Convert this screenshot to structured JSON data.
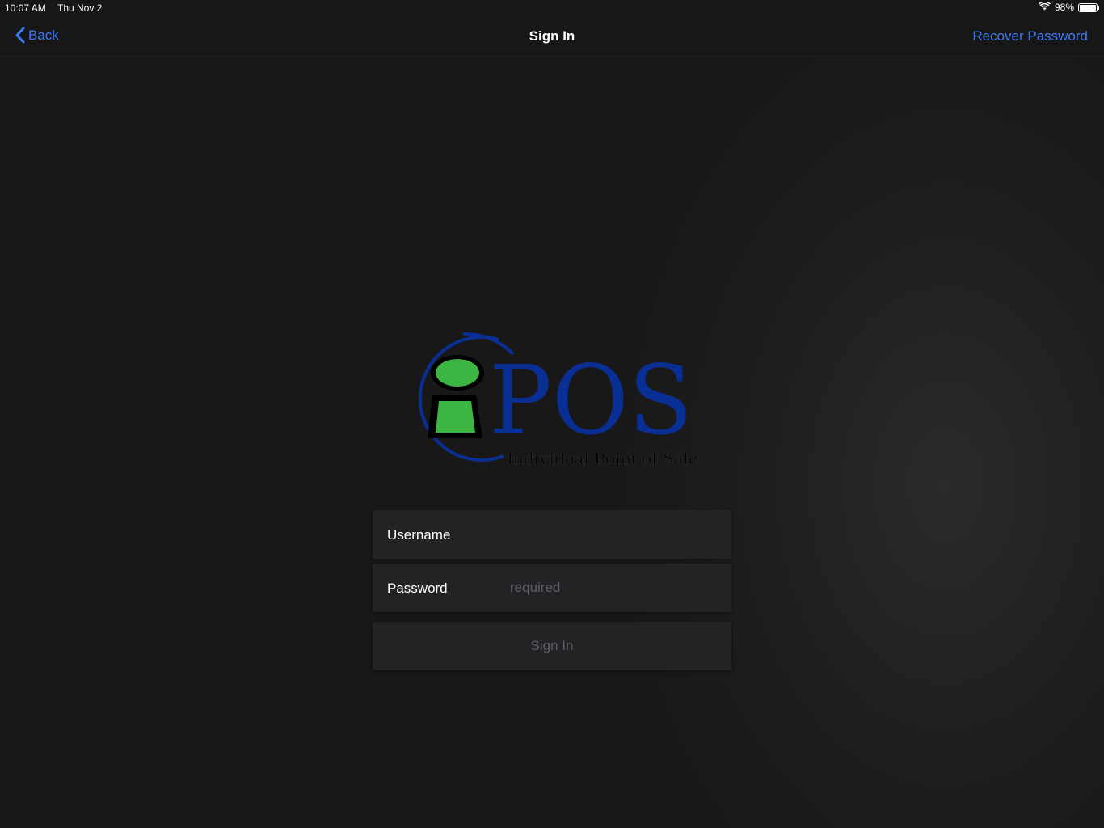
{
  "status_bar": {
    "time": "10:07 AM",
    "date": "Thu Nov 2",
    "battery_percent": "98%",
    "battery_level": 0.98
  },
  "nav": {
    "back_label": "Back",
    "title": "Sign In",
    "recover_label": "Recover Password"
  },
  "logo": {
    "wordmark": "POS",
    "tagline": "Individual Point of Sale"
  },
  "form": {
    "username_label": "Username",
    "username_value": "",
    "password_label": "Password",
    "password_placeholder": "required",
    "sign_in_label": "Sign In"
  },
  "colors": {
    "accent": "#3b7bf6",
    "logo_blue": "#0a2f94",
    "logo_green": "#3cb543",
    "field_background": "#232326",
    "disabled_text": "#5e5e62"
  },
  "icons": {
    "back": "chevron-left-icon",
    "wifi": "wifi-icon",
    "battery": "battery-icon"
  }
}
